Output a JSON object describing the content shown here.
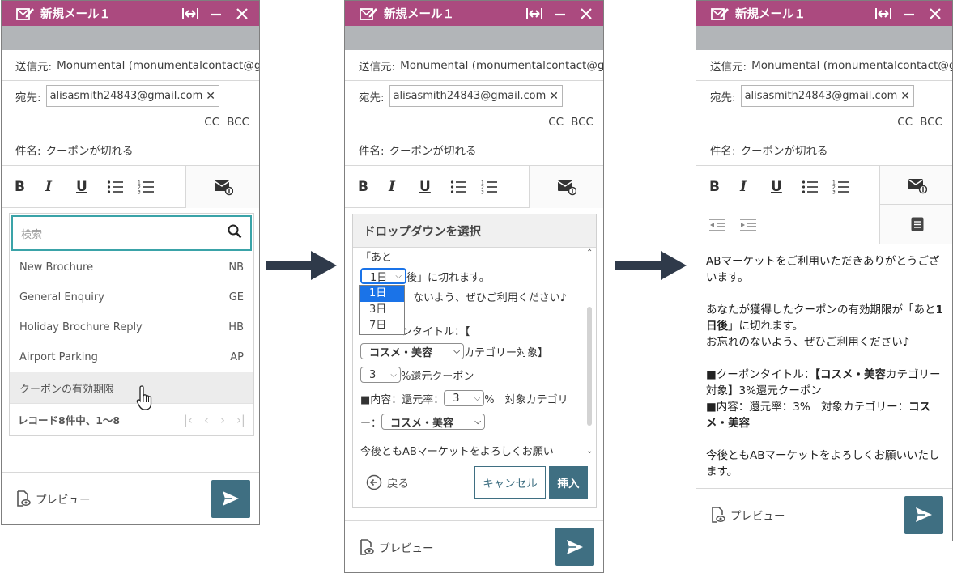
{
  "common": {
    "window_title": "新規メール１",
    "from_label": "送信元:",
    "from_value": "Monumental (monumentalcontact@g...",
    "to_label": "宛先:",
    "to_chip": "alisasmith24843@gmail.com",
    "chip_remove": "✕",
    "cc": "CC",
    "bcc": "BCC",
    "subject_label": "件名:",
    "subject_value": "クーポンが切れる",
    "bold_glyph": "B",
    "italic_glyph": "I",
    "underline_glyph": "U",
    "preview": "プレビュー"
  },
  "panel1": {
    "search_placeholder": "検索",
    "items": [
      {
        "label": "New Brochure",
        "code": "NB"
      },
      {
        "label": "General Enquiry",
        "code": "GE"
      },
      {
        "label": "Holiday Brochure Reply",
        "code": "HB"
      },
      {
        "label": "Airport Parking",
        "code": "AP"
      },
      {
        "label": "クーポンの有効期限",
        "code": ""
      }
    ],
    "pager_text": "レコード8件中、1〜8"
  },
  "panel2": {
    "dialog_title": "ドロップダウンを選択",
    "lines": {
      "l1": "「あと",
      "l2_after": "後」に切れます。",
      "l3_partial": "ないよう、ぜひご利用ください♪",
      "l4_partial": "ンタイトル：【",
      "l5_after": "カテゴリー対象】",
      "l6_after": "%還元クーポン",
      "l7_before": "■内容：還元率：",
      "l7_after": "%　対象カテゴリ",
      "l8_before": "ー：",
      "l9": "今後ともABマーケットをよろしくお願い"
    },
    "selects": {
      "days": "1日",
      "category_1": "コスメ・美容",
      "rate_1": "3",
      "rate_2": "3",
      "category_2": "コスメ・美容"
    },
    "open_options": [
      "1日",
      "3日",
      "7日"
    ],
    "back": "戻る",
    "cancel": "キャンセル",
    "insert": "挿入"
  },
  "panel3": {
    "p1": "ABマーケットをご利用いただきありがとうございます。",
    "p2_a": "あなたが獲得したクーポンの有効期限が「あと",
    "p2_b": "1日後",
    "p2_c": "」に切れます。",
    "p2_d": "お忘れのないよう、ぜひご利用ください♪",
    "p3_a": "■クーポンタイトル：",
    "p3_b": "【コスメ・美容",
    "p3_c": "カテゴリー対象】3%還元クーポン",
    "p3_d": "■内容：還元率：3%　対象カテゴリー：",
    "p3_e": "コスメ・美容",
    "p4": "今後ともABマーケットをよろしくお願いいたします。"
  },
  "colors": {
    "titlebar": "#ab4a7f",
    "accent": "#3f6f82",
    "search_border": "#3aa3a8",
    "arrow": "#2f3a4a"
  }
}
